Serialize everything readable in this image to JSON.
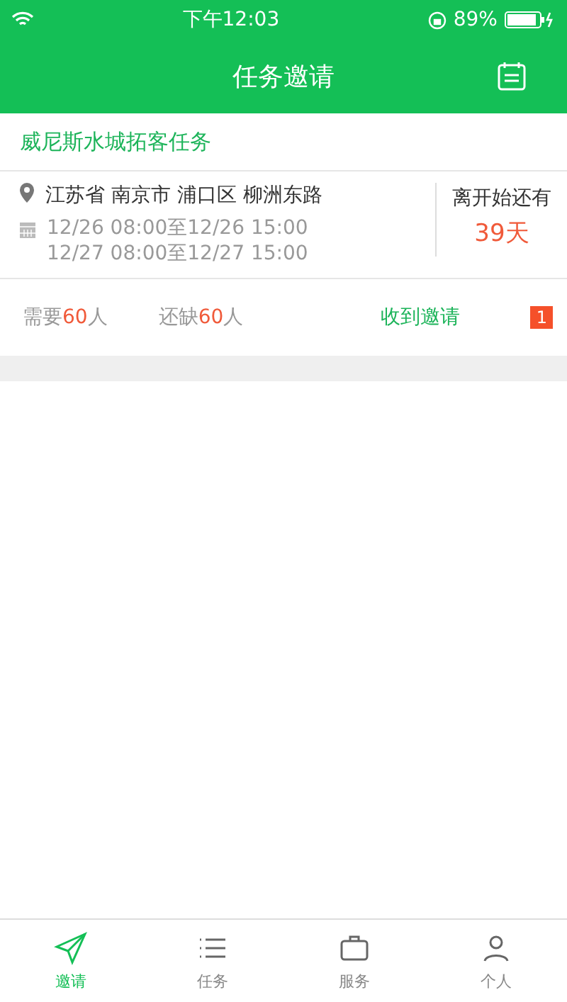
{
  "status_bar": {
    "time": "下午12:03",
    "battery": "89%"
  },
  "header": {
    "title": "任务邀请"
  },
  "task": {
    "title": "威尼斯水城拓客任务",
    "address": "江苏省 南京市 浦口区 柳洲东路",
    "dates": [
      "12/26 08:00至12/26 15:00",
      "12/27 08:00至12/27 15:00"
    ],
    "countdown_label": "离开始还有",
    "countdown": "39天",
    "need_label": "需要",
    "need": "60人",
    "short_label": "还缺",
    "short": "60人",
    "invites_label": "收到邀请",
    "invites_count": "1"
  },
  "tabs": [
    {
      "label": "邀请",
      "kind": "send",
      "selected": true
    },
    {
      "label": "任务",
      "kind": "list",
      "selected": false
    },
    {
      "label": "服务",
      "kind": "service",
      "selected": false
    },
    {
      "label": "个人",
      "kind": "person",
      "selected": false
    }
  ]
}
